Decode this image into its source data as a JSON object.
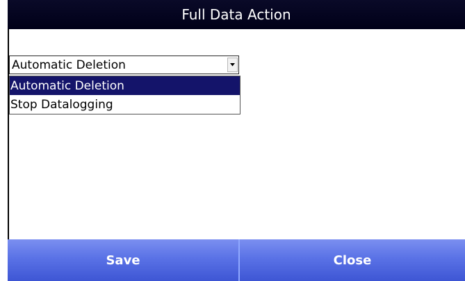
{
  "window": {
    "title": "Full Data Action"
  },
  "combo": {
    "selected_value": "Automatic Deletion",
    "icon": "chevron-down-icon"
  },
  "dropdown": {
    "options": [
      {
        "label": "Automatic Deletion",
        "selected": true
      },
      {
        "label": "Stop Datalogging",
        "selected": false
      }
    ]
  },
  "buttons": {
    "save_label": "Save",
    "close_label": "Close"
  },
  "colors": {
    "titlebar": "#000018",
    "selection": "#14146a",
    "button": "#5a72e6",
    "button_divider": "#8fa8ff"
  }
}
